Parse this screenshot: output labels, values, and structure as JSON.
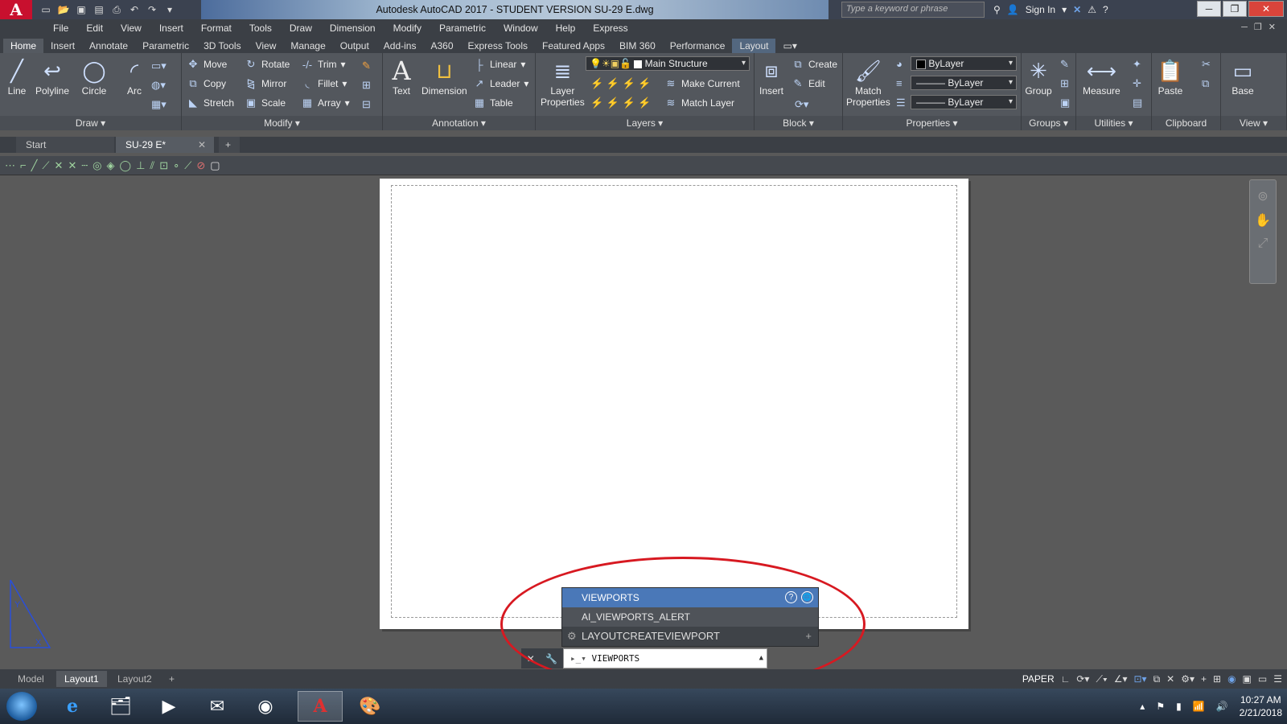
{
  "title": {
    "text": "Autodesk AutoCAD 2017 - STUDENT VERSION    SU-29 E.dwg",
    "search_placeholder": "Type a keyword or phrase",
    "signin": "Sign In"
  },
  "menu": [
    "File",
    "Edit",
    "View",
    "Insert",
    "Format",
    "Tools",
    "Draw",
    "Dimension",
    "Modify",
    "Parametric",
    "Window",
    "Help",
    "Express"
  ],
  "ribbon_tabs": [
    "Home",
    "Insert",
    "Annotate",
    "Parametric",
    "3D Tools",
    "View",
    "Manage",
    "Output",
    "Add-ins",
    "A360",
    "Express Tools",
    "Featured Apps",
    "BIM 360",
    "Performance",
    "Layout"
  ],
  "panels": {
    "draw": {
      "title": "Draw",
      "line": "Line",
      "polyline": "Polyline",
      "circle": "Circle",
      "arc": "Arc"
    },
    "modify": {
      "title": "Modify",
      "move": "Move",
      "rotate": "Rotate",
      "trim": "Trim",
      "copy": "Copy",
      "mirror": "Mirror",
      "fillet": "Fillet",
      "stretch": "Stretch",
      "scale": "Scale",
      "array": "Array"
    },
    "annotation": {
      "title": "Annotation",
      "text": "Text",
      "dimension": "Dimension",
      "linear": "Linear",
      "leader": "Leader",
      "table": "Table"
    },
    "layers": {
      "title": "Layers",
      "layer_props_1": "Layer",
      "layer_props_2": "Properties",
      "current_layer": "Main Structure",
      "make_current": "Make Current",
      "match_layer": "Match Layer"
    },
    "block": {
      "title": "Block",
      "insert": "Insert",
      "create": "Create",
      "edit": "Edit"
    },
    "properties": {
      "title": "Properties",
      "match_1": "Match",
      "match_2": "Properties",
      "color": "ByLayer",
      "linetype": "ByLayer",
      "lineweight": "ByLayer"
    },
    "groups": {
      "title": "Groups",
      "group": "Group"
    },
    "utilities": {
      "title": "Utilities",
      "measure": "Measure"
    },
    "clipboard": {
      "title": "Clipboard",
      "paste": "Paste"
    },
    "view": {
      "title": "View",
      "base": "Base"
    }
  },
  "file_tabs": {
    "start": "Start",
    "doc": "SU-29 E*"
  },
  "autocomplete": {
    "items": [
      "VIEWPORTS",
      "AI_VIEWPORTS_ALERT",
      "LAYOUTCREATEVIEWPORT"
    ]
  },
  "command": {
    "value": "VIEWPORTS"
  },
  "layout_tabs": [
    "Model",
    "Layout1",
    "Layout2"
  ],
  "status": {
    "space": "PAPER"
  },
  "clock": {
    "time": "10:27 AM",
    "date": "2/21/2018"
  }
}
